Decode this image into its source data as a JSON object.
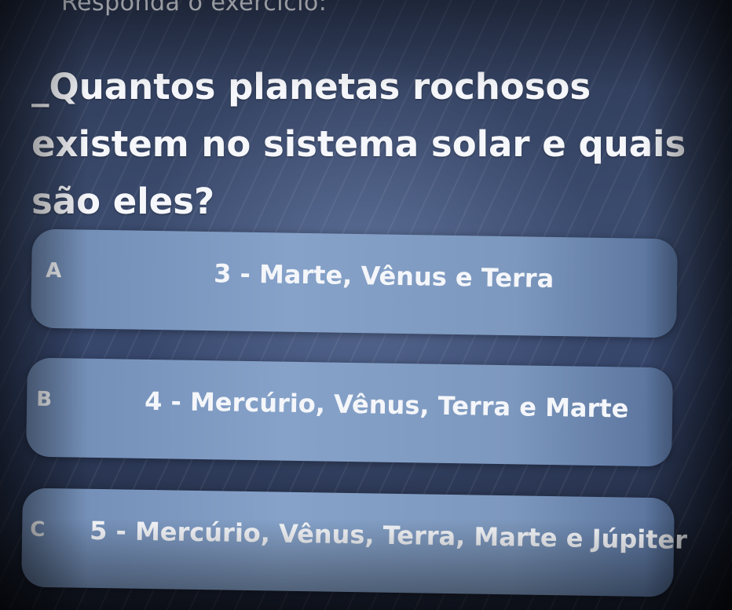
{
  "instruction": "Responda o exercício:",
  "question": {
    "text": "_Quantos planetas rochosos existem no sistema solar e quais são eles?"
  },
  "options": [
    {
      "letter": "A",
      "text": "3 - Marte, Vênus e Terra"
    },
    {
      "letter": "B",
      "text": "4 - Mercúrio, Vênus, Terra e Marte"
    },
    {
      "letter": "C",
      "text": "5 - Mercúrio, Vênus, Terra, Marte e Júpiter"
    }
  ],
  "colors": {
    "background": "#34446a",
    "option_fill": "#86a2c9",
    "text": "#f6f7fb"
  }
}
